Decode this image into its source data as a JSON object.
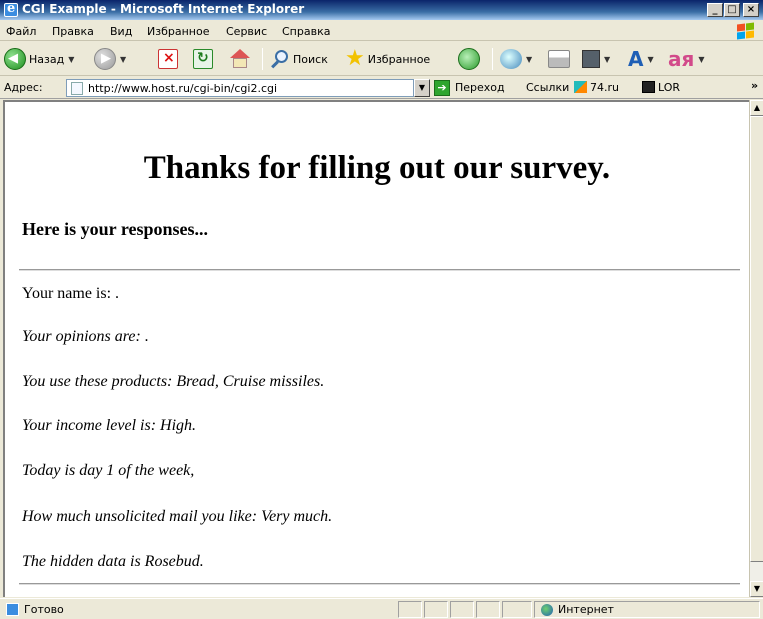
{
  "window": {
    "title": "CGI Example - Microsoft Internet Explorer",
    "minimize": "_",
    "maximize": "□",
    "close": "×"
  },
  "menu": [
    {
      "label": "Файл"
    },
    {
      "label": "Правка"
    },
    {
      "label": "Вид"
    },
    {
      "label": "Избранное"
    },
    {
      "label": "Сервис"
    },
    {
      "label": "Справка"
    }
  ],
  "toolbar": {
    "back_label": "Назад",
    "search_label": "Поиск",
    "favorites_label": "Избранное"
  },
  "address": {
    "label": "Адрес:",
    "url": "http://www.host.ru/cgi-bin/cgi2.cgi",
    "go_label": "Переход",
    "links_label": "Ссылки",
    "link_1": "74.ru",
    "link_2": "LOR",
    "more": "»"
  },
  "page": {
    "heading": "Thanks for filling out our survey.",
    "subheading": "Here is your responses...",
    "lines": [
      "Your name is: .",
      "Your opinions are: .",
      "You use these products: Bread, Cruise missiles.",
      "Your income level is: High.",
      "Today is day 1 of the week,",
      "How much unsolicited mail you like: Very much.",
      "The hidden data is Rosebud."
    ]
  },
  "status": {
    "text": "Готово",
    "zone": "Интернет"
  },
  "colors": {
    "titlebar": "#0a246a",
    "chrome": "#ece9d8",
    "content_bg": "#ffffff"
  }
}
